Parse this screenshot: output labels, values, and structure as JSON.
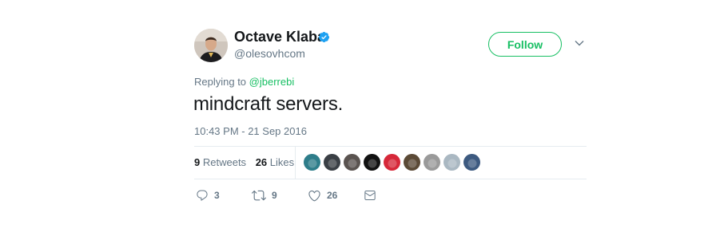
{
  "user": {
    "display_name": "Octave Klaba",
    "handle": "@olesovhcom",
    "verified": true
  },
  "follow_label": "Follow",
  "reply_context": {
    "prefix": "Replying to",
    "mention": "@jberrebi"
  },
  "tweet": {
    "text": "mindcraft servers.",
    "timestamp": "10:43 PM - 21 Sep 2016"
  },
  "stats": {
    "retweets_count": "9",
    "retweets_label": "Retweets",
    "likes_count": "26",
    "likes_label": "Likes"
  },
  "liker_avatars": [
    "#2e7d8a",
    "#3a3f45",
    "#5a5350",
    "#111111",
    "#d62839",
    "#5b4a36",
    "#9a9a9a",
    "#aab8c2",
    "#3d5a80"
  ],
  "actions": {
    "reply_count": "3",
    "retweet_count": "9",
    "like_count": "26"
  },
  "colors": {
    "accent": "#17bf63",
    "text": "#14171a",
    "secondary": "#657786",
    "verified": "#1da1f2",
    "divider": "#e6ecf0"
  },
  "icons": [
    "verified-badge-icon",
    "chevron-down-icon",
    "reply-icon",
    "retweet-icon",
    "heart-icon",
    "direct-message-icon"
  ]
}
